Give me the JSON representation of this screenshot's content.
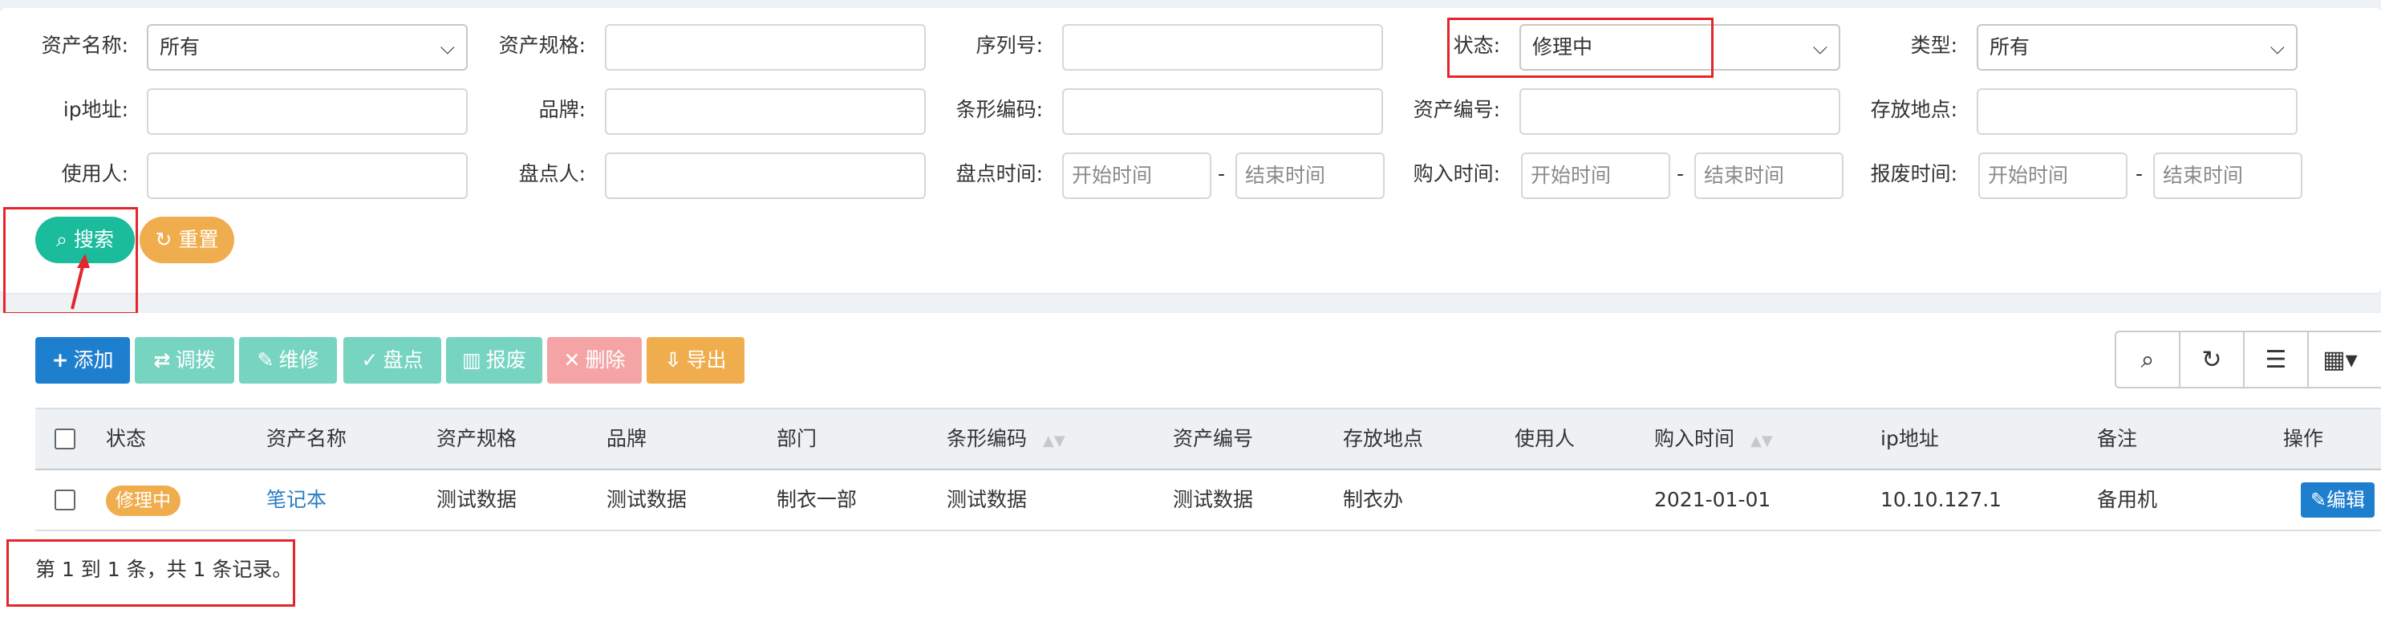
{
  "filters": {
    "asset_name": {
      "label": "资产名称:",
      "value": "所有"
    },
    "asset_spec": {
      "label": "资产规格:",
      "value": ""
    },
    "serial_no": {
      "label": "序列号:",
      "value": ""
    },
    "status": {
      "label": "状态:",
      "value": "修理中"
    },
    "type": {
      "label": "类型:",
      "value": "所有"
    },
    "ip": {
      "label": "ip地址:",
      "value": ""
    },
    "brand": {
      "label": "品牌:",
      "value": ""
    },
    "barcode": {
      "label": "条形编码:",
      "value": ""
    },
    "asset_no": {
      "label": "资产编号:",
      "value": ""
    },
    "location": {
      "label": "存放地点:",
      "value": ""
    },
    "user": {
      "label": "使用人:",
      "value": ""
    },
    "checker": {
      "label": "盘点人:",
      "value": ""
    },
    "check_time": {
      "label": "盘点时间:",
      "start_placeholder": "开始时间",
      "end_placeholder": "结束时间"
    },
    "purchase_time": {
      "label": "购入时间:",
      "start_placeholder": "开始时间",
      "end_placeholder": "结束时间"
    },
    "scrap_time": {
      "label": "报废时间:",
      "start_placeholder": "开始时间",
      "end_placeholder": "结束时间"
    },
    "dash": "-",
    "search_label": "搜索",
    "reset_label": "重置"
  },
  "toolbar": {
    "add": "添加",
    "transfer": "调拨",
    "repair": "维修",
    "inventory": "盘点",
    "scrap": "报废",
    "delete": "删除",
    "export": "导出"
  },
  "colors": {
    "primary": "#1f7fcf",
    "success": "#1abc9c",
    "warning": "#f0ad4e",
    "danger_light": "#f4a4a4",
    "teal_light": "#76d4c1",
    "highlight": "#e4252b"
  },
  "table": {
    "headers": [
      "状态",
      "资产名称",
      "资产规格",
      "品牌",
      "部门",
      "条形编码",
      "资产编号",
      "存放地点",
      "使用人",
      "购入时间",
      "ip地址",
      "备注",
      "操作"
    ],
    "rows": [
      {
        "status": "修理中",
        "name": "笔记本",
        "spec": "测试数据",
        "brand": "测试数据",
        "dept": "制衣一部",
        "barcode": "测试数据",
        "asset_no": "测试数据",
        "location": "制衣办",
        "user": "",
        "purchase": "2021-01-01",
        "ip": "10.10.127.1",
        "remark": "备用机",
        "action": "编辑"
      }
    ],
    "footer": "第 1 到 1 条，共 1 条记录。"
  }
}
